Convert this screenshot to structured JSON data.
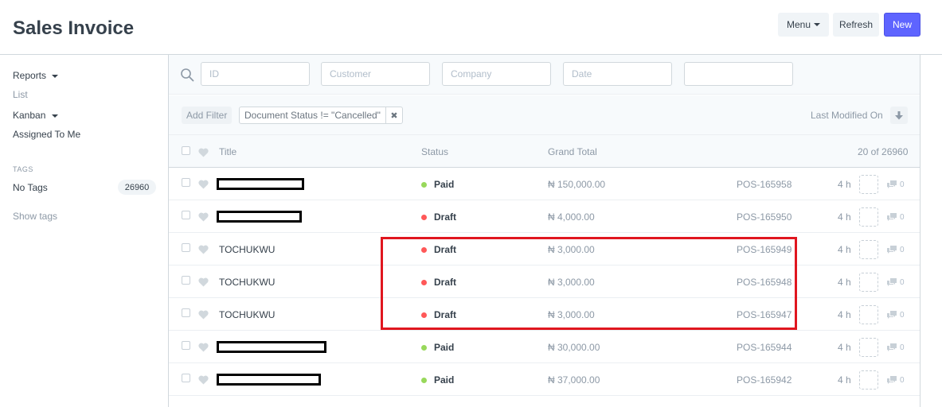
{
  "header": {
    "title": "Sales Invoice",
    "menu_label": "Menu",
    "refresh_label": "Refresh",
    "new_label": "New"
  },
  "sidebar": {
    "reports": "Reports",
    "list": "List",
    "kanban": "Kanban",
    "assigned": "Assigned To Me",
    "tags_heading": "TAGS",
    "no_tags": "No Tags",
    "no_tags_count": "26960",
    "show_tags": "Show tags"
  },
  "filters": {
    "id_placeholder": "ID",
    "customer_placeholder": "Customer",
    "company_placeholder": "Company",
    "date_placeholder": "Date",
    "add_filter": "Add Filter",
    "active_filter": "Document Status != \"Cancelled\"",
    "sort_label": "Last Modified On"
  },
  "table": {
    "headers": {
      "title": "Title",
      "status": "Status",
      "grand_total": "Grand Total",
      "count": "20 of 26960"
    },
    "rows": [
      {
        "title": "",
        "redacted": true,
        "status": "Paid",
        "total": "₦ 150,000.00",
        "name": "POS-165958",
        "modified": "4 h",
        "comments": "0"
      },
      {
        "title": "",
        "redacted": true,
        "status": "Draft",
        "total": "₦ 4,000.00",
        "name": "POS-165950",
        "modified": "4 h",
        "comments": "0"
      },
      {
        "title": "TOCHUKWU",
        "redacted": false,
        "status": "Draft",
        "total": "₦ 3,000.00",
        "name": "POS-165949",
        "modified": "4 h",
        "comments": "0"
      },
      {
        "title": "TOCHUKWU",
        "redacted": false,
        "status": "Draft",
        "total": "₦ 3,000.00",
        "name": "POS-165948",
        "modified": "4 h",
        "comments": "0"
      },
      {
        "title": "TOCHUKWU",
        "redacted": false,
        "status": "Draft",
        "total": "₦ 3,000.00",
        "name": "POS-165947",
        "modified": "4 h",
        "comments": "0"
      },
      {
        "title": "",
        "redacted": true,
        "status": "Paid",
        "total": "₦ 30,000.00",
        "name": "POS-165944",
        "modified": "4 h",
        "comments": "0"
      },
      {
        "title": "",
        "redacted": true,
        "status": "Paid",
        "total": "₦ 37,000.00",
        "name": "POS-165942",
        "modified": "4 h",
        "comments": "0"
      }
    ]
  },
  "colors": {
    "paid": "#98d85b",
    "draft": "#ff5858",
    "primary": "#5e64ff",
    "highlight": "#e0161f"
  }
}
